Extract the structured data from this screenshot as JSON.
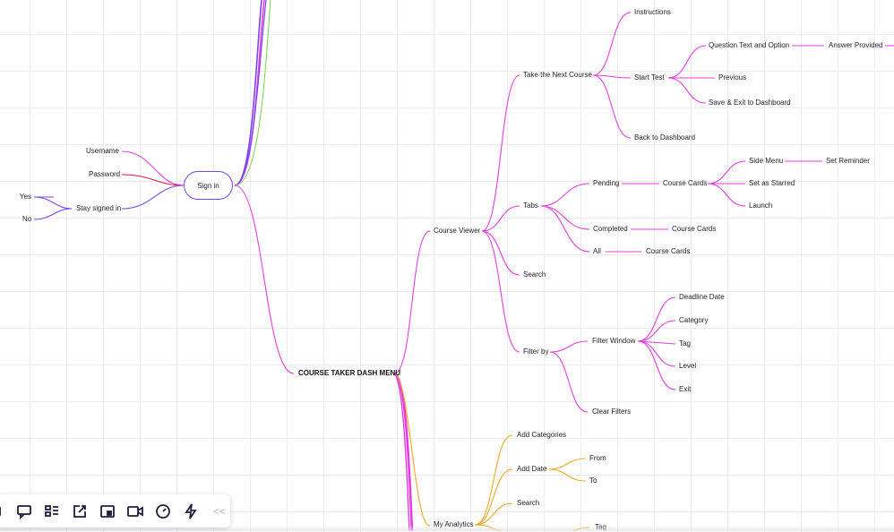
{
  "colors": {
    "magenta": "#e63ce0",
    "purple": "#7a45f0",
    "orange": "#f4a623",
    "green": "#7ed04b",
    "red": "#e0183c"
  },
  "signin": {
    "center": "Sign in",
    "username": "Username",
    "password": "Password",
    "stay_signed_in": "Stay signed in",
    "yes": "Yes",
    "no": "No"
  },
  "menu": {
    "root": "COURSE TAKER DASH MENU",
    "course_viewer": "Course Viewer",
    "take_next_course": "Take the Next Course",
    "instructions": "Instructions",
    "start_test": "Start Test",
    "question_text": "Question Text and Option",
    "answer_provided": "Answer Provided",
    "previous": "Previous",
    "save_exit": "Save & Exit to Dashboard",
    "back_dashboard": "Back to Dashboard",
    "tabs": "Tabs",
    "pending": "Pending",
    "course_cards_pending": "Course Cards",
    "side_menu": "Side Menu",
    "set_reminder": "Set Reminder",
    "set_starred": "Set as Starred",
    "launch": "Launch",
    "completed": "Completed",
    "course_cards_completed": "Course Cards",
    "all": "All",
    "course_cards_all": "Course Cards",
    "search": "Search",
    "filter_by": "Filter by",
    "filter_window": "Filter Window",
    "deadline_date": "Deadline Date",
    "category": "Category",
    "tag": "Tag",
    "level": "Level",
    "exit": "Exit",
    "clear_filters": "Clear Filters",
    "my_analytics": "My Analytics",
    "add_categories": "Add Categories",
    "add_date": "Add Date",
    "from": "From",
    "to": "To",
    "analytics_search": "Search",
    "analytics_tag": "Tag"
  },
  "toolbar": {
    "icons": [
      "frame-icon",
      "comment-icon",
      "kanban-icon",
      "share-icon",
      "sticky-icon",
      "video-icon",
      "timer-icon",
      "lightning-icon"
    ],
    "collapse": "<<"
  }
}
